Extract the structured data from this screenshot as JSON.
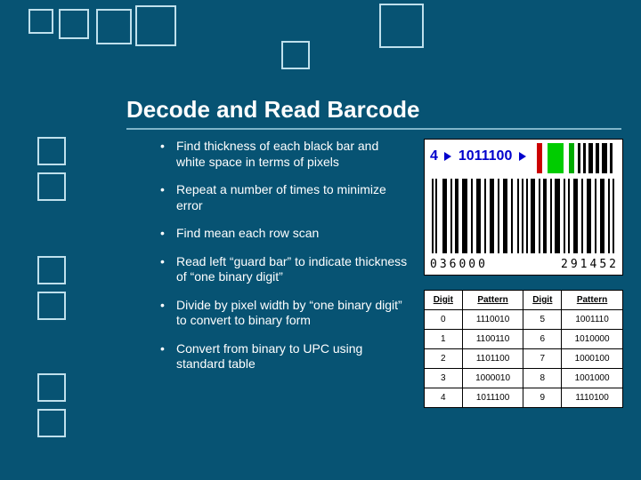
{
  "title": "Decode and Read Barcode",
  "bullets": [
    "Find thickness of each black bar and white space in terms of pixels",
    "Repeat a number of times to minimize error",
    "Find mean each row scan",
    "Read left “guard bar” to indicate thickness of “one binary digit”",
    "Divide by pixel width by “one binary digit” to convert to binary form",
    "Convert from binary to UPC using standard table"
  ],
  "barcode": {
    "decoded_digit": "4",
    "decoded_pattern": "1011100",
    "numbers_left": "036000",
    "numbers_right": "291452"
  },
  "table": {
    "headers": [
      "Digit",
      "Pattern",
      "Digit",
      "Pattern"
    ],
    "rows": [
      [
        "0",
        "1110010",
        "5",
        "1001110"
      ],
      [
        "1",
        "1100110",
        "6",
        "1010000"
      ],
      [
        "2",
        "1101100",
        "7",
        "1000100"
      ],
      [
        "3",
        "1000010",
        "8",
        "1001000"
      ],
      [
        "4",
        "1011100",
        "9",
        "1110100"
      ]
    ]
  }
}
